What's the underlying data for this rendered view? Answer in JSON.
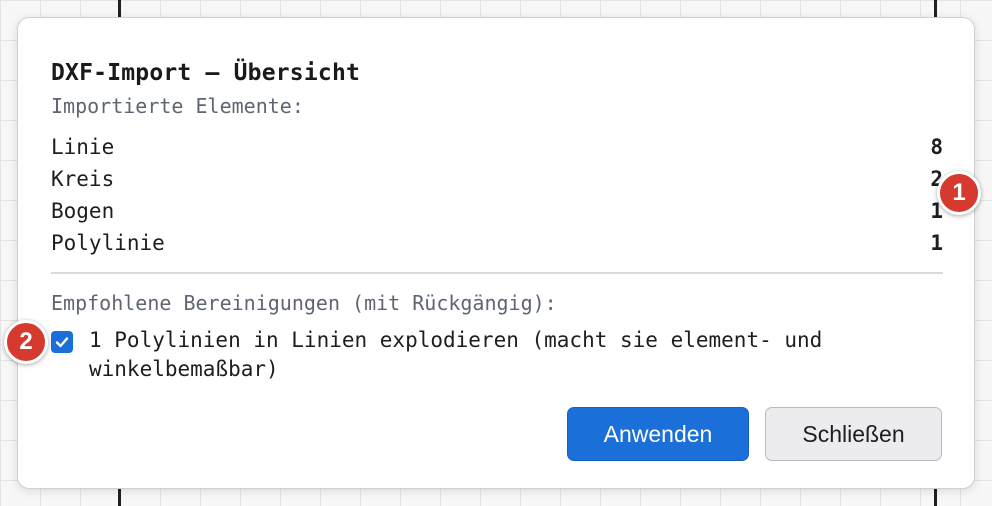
{
  "dialog": {
    "title": "DXF-Import — Übersicht",
    "imported_label": "Importierte Elemente:",
    "elements": [
      {
        "name": "Linie",
        "count": "8"
      },
      {
        "name": "Kreis",
        "count": "2"
      },
      {
        "name": "Bogen",
        "count": "1"
      },
      {
        "name": "Polylinie",
        "count": "1"
      }
    ],
    "cleanup_label": "Empfohlene Bereinigungen (mit Rückgängig):",
    "cleanup_option": {
      "checked": true,
      "label": "1 Polylinien in Linien explodieren (macht sie element- und winkelbemaßbar)"
    },
    "apply_button": "Anwenden",
    "close_button": "Schließen"
  },
  "annotations": [
    {
      "label": "1"
    },
    {
      "label": "2"
    }
  ],
  "colors": {
    "accent": "#1a6fd8",
    "badge": "#d63a2f",
    "muted_text": "#5f6672"
  },
  "icons": {
    "checkbox": "checkmark-icon"
  }
}
